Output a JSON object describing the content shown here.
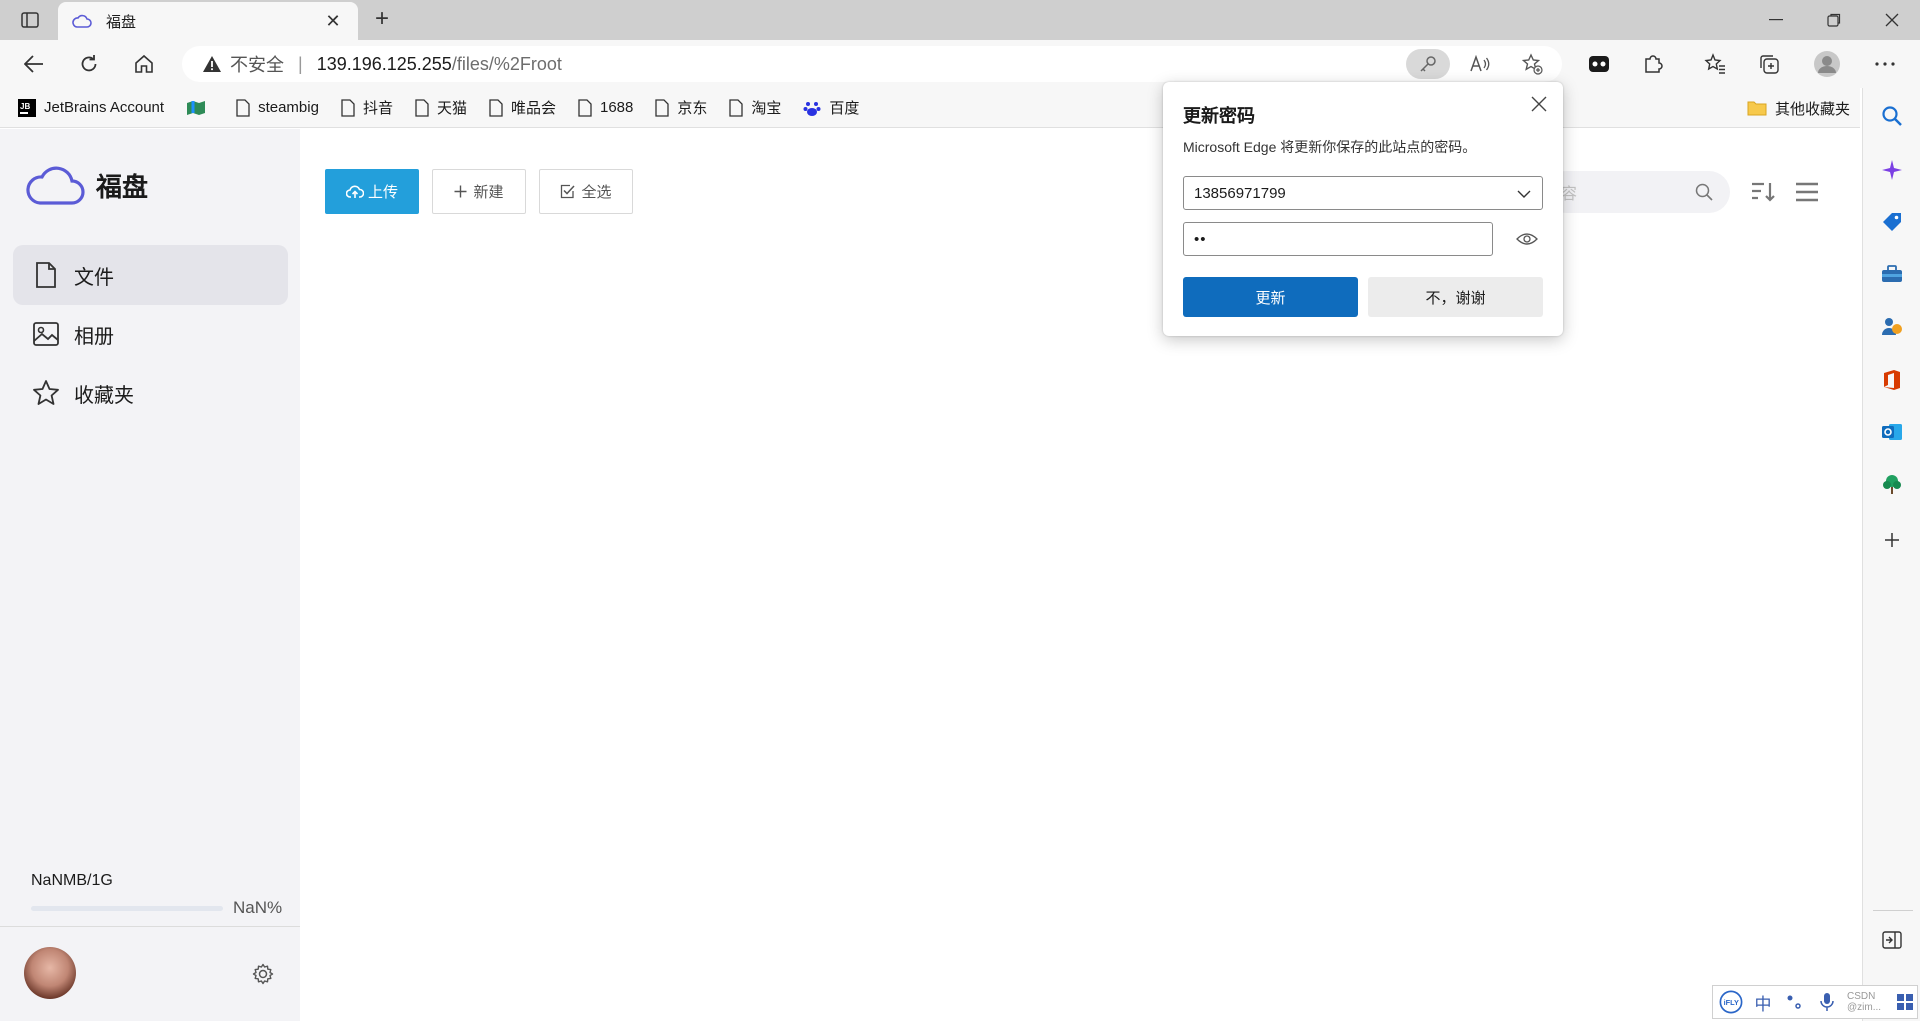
{
  "browser": {
    "tab_title": "福盘",
    "address": {
      "security_label": "不安全",
      "host": "139.196.125.255",
      "path": "/files/%2Froot"
    },
    "bookmarks": [
      {
        "label": "JetBrains Account",
        "icon": "jetbrains-icon"
      },
      {
        "label": "",
        "icon": "map-icon"
      },
      {
        "label": "steambig",
        "icon": "page-icon"
      },
      {
        "label": "抖音",
        "icon": "page-icon"
      },
      {
        "label": "天猫",
        "icon": "page-icon"
      },
      {
        "label": "唯品会",
        "icon": "page-icon"
      },
      {
        "label": "1688",
        "icon": "page-icon"
      },
      {
        "label": "京东",
        "icon": "page-icon"
      },
      {
        "label": "淘宝",
        "icon": "page-icon"
      },
      {
        "label": "百度",
        "icon": "baidu-icon"
      }
    ],
    "other_favorites": "其他收藏夹"
  },
  "app": {
    "logo_text": "福盘",
    "nav": [
      {
        "label": "文件",
        "icon": "file-icon",
        "active": true
      },
      {
        "label": "相册",
        "icon": "image-icon",
        "active": false
      },
      {
        "label": "收藏夹",
        "icon": "star-icon",
        "active": false
      }
    ],
    "storage": {
      "used_text": "NaNMB/1G",
      "percent_text": "NaN%",
      "fill_fraction": 0
    },
    "toolbar": {
      "upload_label": "上传",
      "new_label": "新建",
      "select_all_label": "全选",
      "search_placeholder": "容"
    }
  },
  "password_popup": {
    "title": "更新密码",
    "description": "Microsoft Edge 将更新你保存的此站点的密码。",
    "username": "13856971799",
    "password_mask": "••",
    "update_label": "更新",
    "decline_label": "不，谢谢"
  },
  "ime": {
    "mode": "中",
    "watermark": "CSDN @zim..."
  },
  "colors": {
    "upload_button": "#239fdb",
    "update_button": "#0f6cbd",
    "sidebar_bg": "#f3f3f6"
  }
}
